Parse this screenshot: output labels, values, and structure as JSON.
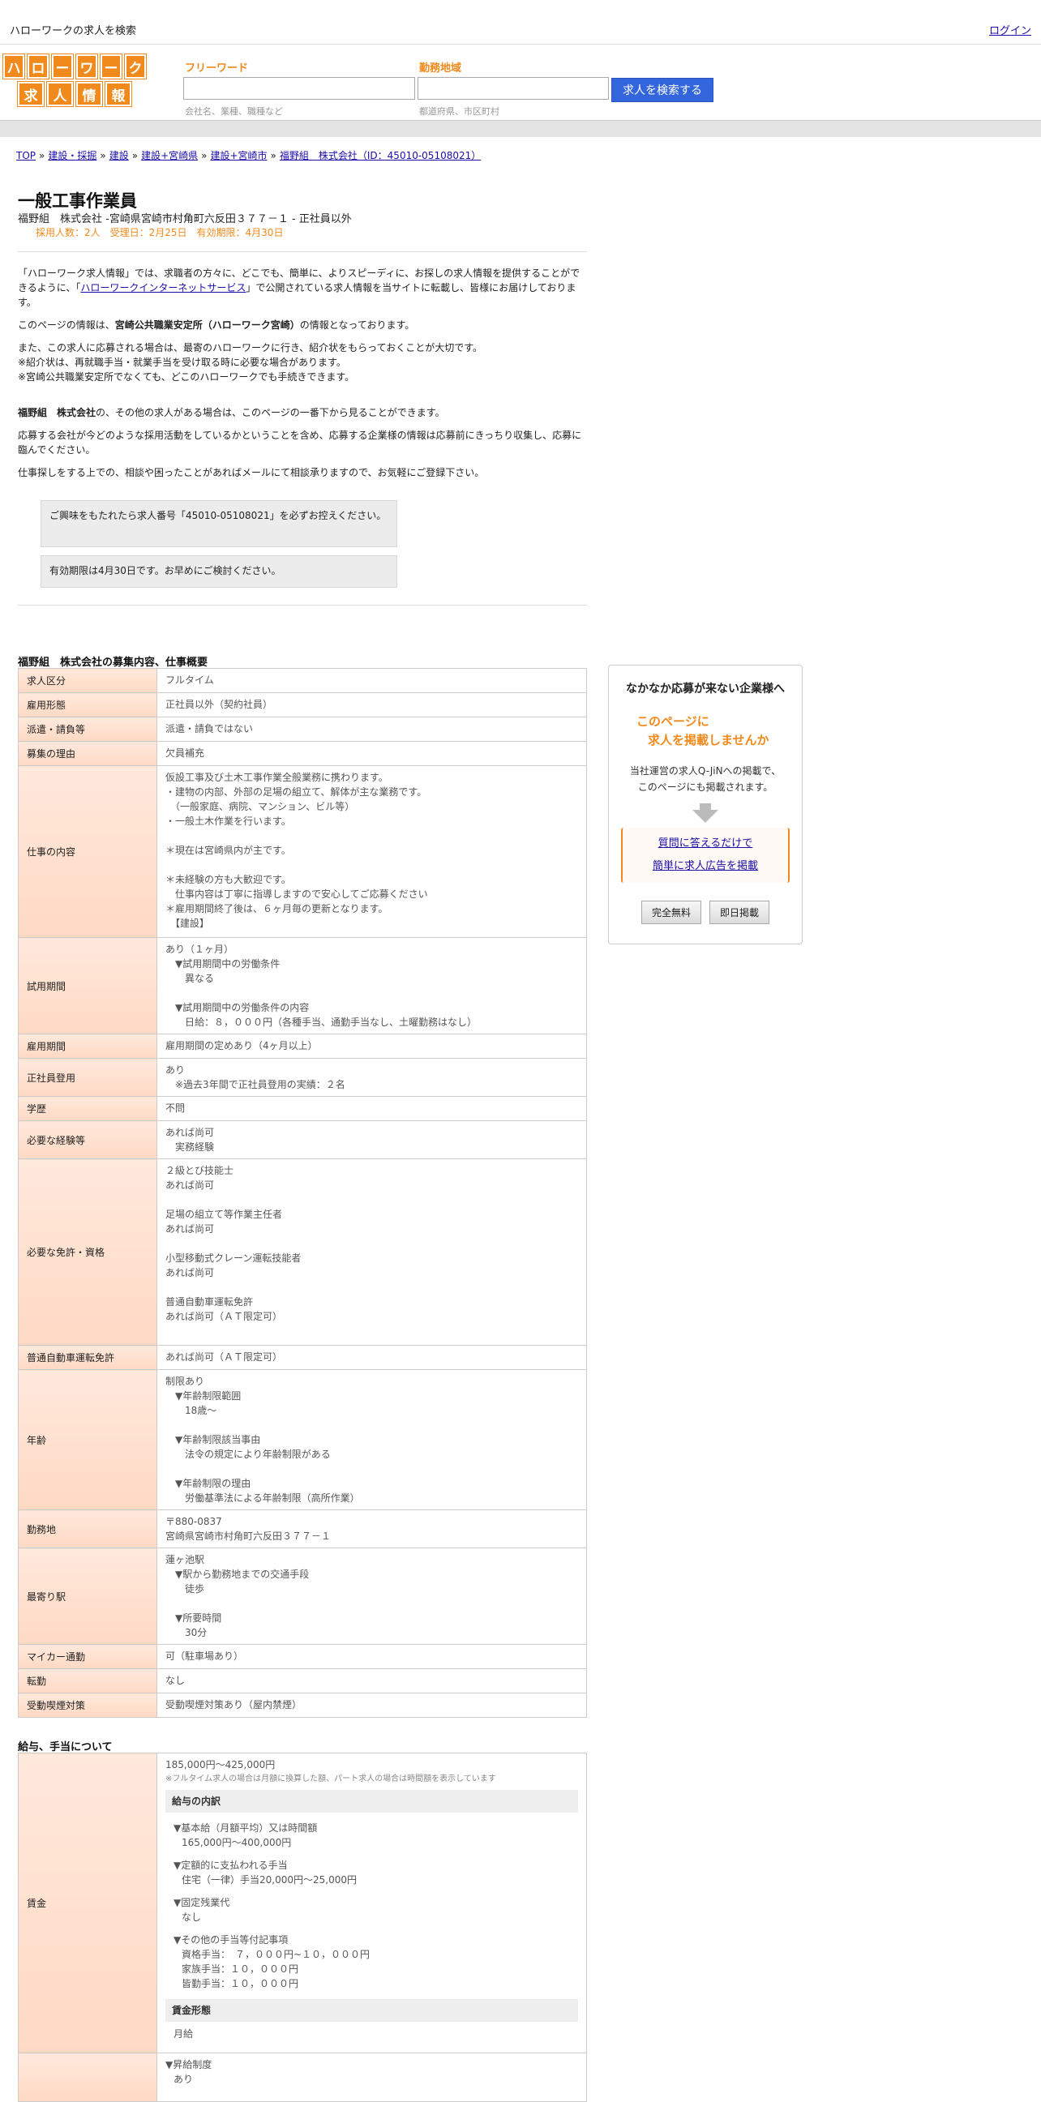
{
  "topbar": {
    "site_title": "ハローワークの求人を検索",
    "login": "ログイン"
  },
  "logo": {
    "row1": [
      "ハ",
      "ロ",
      "ー",
      "ワ",
      "ー",
      "ク"
    ],
    "row2": [
      "求",
      "人",
      "情",
      "報"
    ]
  },
  "search": {
    "keyword_label": "フリーワード",
    "keyword_hint": "会社名、業種、職種など",
    "area_label": "勤務地域",
    "area_hint": "都道府県、市区町村",
    "button": "求人を検索する"
  },
  "breadcrumb": {
    "items": [
      "TOP",
      "建設・採掘",
      "建設",
      "建設+宮崎県",
      "建設+宮崎市",
      "福野組　株式会社（ID：45010-05108021）"
    ],
    "sep": "»"
  },
  "job": {
    "title": "一般工事作業員",
    "subtitle": "福野組　株式会社 -宮崎県宮崎市村角町六反田３７７－１ - 正社員以外",
    "meta": "採用人数：2人　受理日：2月25日　有効期限：4月30日"
  },
  "intro": {
    "p1a": "「ハローワーク求人情報」では、求職者の方々に、どこでも、簡単に、よりスピーディに、お探しの求人情報を提供することができるように、「",
    "p1link": "ハローワークインターネットサービス",
    "p1b": "」で公開されている求人情報を当サイトに転載し、皆様にお届けしております。",
    "p2a": "このページの情報は、",
    "p2b": "宮崎公共職業安定所（ハローワーク宮崎）",
    "p2c": "の情報となっております。",
    "p3": "また、この求人に応募される場合は、最寄のハローワークに行き、紹介状をもらっておくことが大切です。",
    "p4": "※紹介状は、再就職手当・就業手当を受け取る時に必要な場合があります。",
    "p5": "※宮崎公共職業安定所でなくても、どこのハローワークでも手続きできます。",
    "p6a": "福野組　株式会社",
    "p6b": "の、その他の求人がある場合は、このページの一番下から見ることができます。",
    "p7": "応募する会社が今どのような採用活動をしているかということを含め、応募する企業様の情報は応募前にきっちり収集し、応募に臨んでください。",
    "p8": "仕事探しをする上での、相談や困ったことがあればメールにて相談承りますので、お気軽にご登録下さい。"
  },
  "notices": {
    "n1": "ご興味をもたれたら求人番号「45010-05108021」を必ずお控えください。",
    "n2": "有効期限は4月30日です。お早めにご検討ください。"
  },
  "section1": {
    "title": "福野組　株式会社の募集内容、仕事概要"
  },
  "spec": [
    {
      "k": "求人区分",
      "v": "フルタイム"
    },
    {
      "k": "雇用形態",
      "v": "正社員以外（契約社員）"
    },
    {
      "k": "派遣・請負等",
      "v": "派遣・請負ではない"
    },
    {
      "k": "募集の理由",
      "v": "欠員補充"
    },
    {
      "k": "仕事の内容",
      "v": "仮設工事及び土木工事作業全般業務に携わります。\n・建物の内部、外部の足場の組立て、解体が主な業務です。\n　（一般家庭、病院、マンション、ビル等）\n・一般土木作業を行います。\n\n＊現在は宮崎県内が主です。\n\n＊未経験の方も大歓迎です。\n　仕事内容は丁寧に指導しますので安心してご応募ください\n＊雇用期間終了後は、６ヶ月毎の更新となります。\n　【建設】"
    },
    {
      "k": "試用期間",
      "v": "あり（１ヶ月）\n　▼試用期間中の労働条件\n　　異なる\n\n　▼試用期間中の労働条件の内容\n　　日給：８，０００円（各種手当、通勤手当なし、土曜勤務はなし）"
    },
    {
      "k": "雇用期間",
      "v": "雇用期間の定めあり（4ヶ月以上）"
    },
    {
      "k": "正社員登用",
      "v": "あり\n　※過去3年間で正社員登用の実績：２名"
    },
    {
      "k": "学歴",
      "v": "不問"
    },
    {
      "k": "必要な経験等",
      "v": "あれば尚可\n　実務経験"
    },
    {
      "k": "必要な免許・資格",
      "v": "２級とび技能士\nあれば尚可\n\n足場の組立て等作業主任者\nあれば尚可\n\n小型移動式クレーン運転技能者\nあれば尚可\n\n普通自動車運転免許\nあれば尚可（ＡＴ限定可）\n"
    },
    {
      "k": "普通自動車運転免許",
      "v": "あれば尚可（ＡＴ限定可）"
    },
    {
      "k": "年齢",
      "v": "制限あり\n　▼年齢制限範囲\n　　18歳〜\n\n　▼年齢制限該当事由\n　　法令の規定により年齢制限がある\n\n　▼年齢制限の理由\n　　労働基準法による年齢制限（高所作業）"
    },
    {
      "k": "勤務地",
      "v": "〒880-0837\n宮崎県宮崎市村角町六反田３７７－１"
    },
    {
      "k": "最寄り駅",
      "v": "蓮ヶ池駅\n　▼駅から勤務地までの交通手段\n　　徒歩\n\n　▼所要時間\n　　30分"
    },
    {
      "k": "マイカー通勤",
      "v": "可（駐車場あり）"
    },
    {
      "k": "転勤",
      "v": "なし"
    },
    {
      "k": "受動喫煙対策",
      "v": "受動喫煙対策あり（屋内禁煙）"
    }
  ],
  "section2": {
    "title": "給与、手当について"
  },
  "wage": {
    "k": "賃金",
    "range": "185,000円〜425,000円",
    "note": "※フルタイム求人の場合は月額に換算した額、パート求人の場合は時間額を表示しています",
    "sub1": "給与の内訳",
    "b1h": "▼基本給（月額平均）又は時間額",
    "b1v": "165,000円〜400,000円",
    "b2h": "▼定額的に支払われる手当",
    "b2v": "住宅（一律）手当20,000円〜25,000円",
    "b3h": "▼固定残業代",
    "b3v": "なし",
    "b4h": "▼その他の手当等付記事項",
    "b4v1": "資格手当：　７，０００円~１０，０００円",
    "b4v2": "家族手当：１０，０００円",
    "b4v3": "皆勤手当：１０，０００円",
    "sub2": "賃金形態",
    "form": "月給"
  },
  "raise": {
    "v1": "▼昇給制度",
    "v2": "あり"
  },
  "ad": {
    "heading": "なかなか応募が来ない企業様へ",
    "orange1": "このページに",
    "orange2": "求人を掲載しませんか",
    "desc1": "当社運営の求人Q-JiNへの掲載で、",
    "desc2": "このページにも掲載されます。",
    "link1": "質問に答えるだけで",
    "link2": "簡単に求人広告を掲載",
    "btn1": "完全無料",
    "btn2": "即日掲載"
  },
  "colors": {
    "accent": "#f08a1c",
    "button": "#3366dd",
    "th_bg": "#ffe0cf"
  }
}
